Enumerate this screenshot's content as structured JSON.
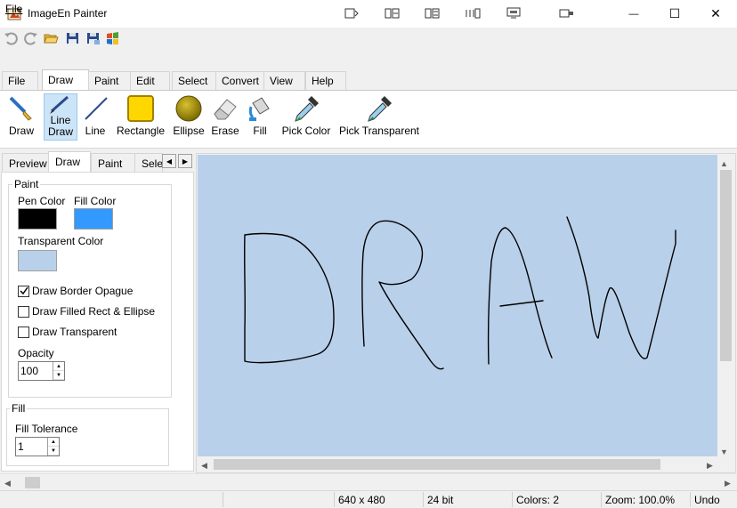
{
  "window": {
    "title": "ImageEn Painter",
    "controls": {
      "minimize": "—",
      "maximize": "☐",
      "close": "✕"
    }
  },
  "quick_access_icons": [
    "undo-icon",
    "redo-icon",
    "open-folder-icon",
    "save-icon",
    "save-as-icon",
    "windows-logo-icon"
  ],
  "menu": {
    "file": "File"
  },
  "ribbon": {
    "tabs": [
      "File",
      "Draw",
      "Paint",
      "Edit",
      "Select",
      "Convert",
      "View",
      "Help"
    ],
    "active_tab": "Draw",
    "buttons": [
      {
        "label": "Draw",
        "icon": "brush-icon"
      },
      {
        "label_line1": "Line",
        "label_line2": "Draw",
        "icon": "pencil-icon",
        "selected": true
      },
      {
        "label": "Line",
        "icon": "line-icon"
      },
      {
        "label": "Rectangle",
        "icon": "rectangle-icon"
      },
      {
        "label": "Ellipse",
        "icon": "ellipse-icon"
      },
      {
        "label": "Erase",
        "icon": "eraser-icon"
      },
      {
        "label": "Fill",
        "icon": "paint-bucket-icon"
      },
      {
        "label": "Pick Color",
        "icon": "eyedropper-icon"
      },
      {
        "label": "Pick Transparent",
        "icon": "eyedropper-transparent-icon"
      }
    ]
  },
  "panel": {
    "tabs": [
      "Preview",
      "Draw",
      "Paint",
      "Sele"
    ],
    "active_tab": "Draw",
    "paint_group": {
      "legend": "Paint",
      "pen_color_label": "Pen Color",
      "fill_color_label": "Fill Color",
      "transparent_color_label": "Transparent Color",
      "pen_color": "#000000",
      "fill_color": "#3399ff",
      "transparent_color": "#b9d0ea",
      "checkboxes": [
        {
          "label": "Draw Border Opague",
          "checked": true
        },
        {
          "label": "Draw Filled Rect & Ellipse",
          "checked": false
        },
        {
          "label": "Draw Transparent",
          "checked": false
        }
      ],
      "opacity_label": "Opacity",
      "opacity_value": "100"
    },
    "fill_group": {
      "legend": "Fill",
      "tolerance_label": "Fill Tolerance",
      "tolerance_value": "1"
    }
  },
  "canvas": {
    "background": "#b9d0ea",
    "stroke_color": "#000000"
  },
  "status": {
    "size": "640 x 480",
    "depth": "24 bit",
    "colors": "Colors: 2",
    "zoom": "Zoom: 100.0%",
    "undo": "Undo"
  }
}
